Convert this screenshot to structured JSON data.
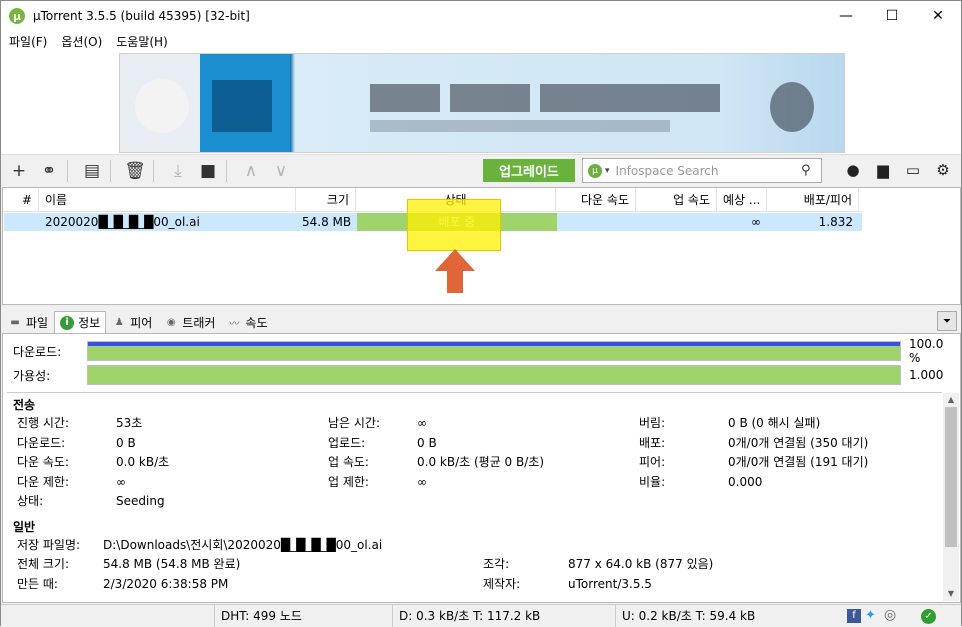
{
  "app": {
    "title": "µTorrent 3.5.5  (build 45395) [32-bit]",
    "logo": "µ"
  },
  "window_controls": {
    "minimize": "—",
    "maximize": "☐",
    "close": "✕"
  },
  "menu": [
    "파일(F)",
    "옵션(O)",
    "도움말(H)"
  ],
  "toolbar": {
    "upgrade_label": "업그레이드",
    "search_placeholder": "Infospace Search"
  },
  "columns": [
    "#",
    "이름",
    "크기",
    "상태",
    "다운 속도",
    "업 속도",
    "예상 ...",
    "배포/피어"
  ],
  "torrent": {
    "name": "2020020█_█_█_█00_ol.ai",
    "size": "54.8 MB",
    "status": "배포 중",
    "eta": "∞",
    "ratio": "1.832"
  },
  "tabs": [
    "파일",
    "정보",
    "피어",
    "트래커",
    "속도"
  ],
  "progress": {
    "download_label": "다운로드:",
    "download_value": "100.0 %",
    "availability_label": "가용성:",
    "availability_value": "1.000",
    "download_fraction": 1.0
  },
  "transfer": {
    "section": "전송",
    "elapsed_label": "진행 시간:",
    "elapsed": "53초",
    "remaining_label": "남은 시간:",
    "remaining": "∞",
    "wasted_label": "버림:",
    "wasted": "0 B (0 해시 실패)",
    "downloaded_label": "다운로드:",
    "downloaded": "0 B",
    "uploaded_label": "업로드:",
    "uploaded": "0 B",
    "seeds_label": "배포:",
    "seeds": "0개/0개 연결됨 (350 대기)",
    "dlspeed_label": "다운 속도:",
    "dlspeed": "0.0 kB/초",
    "ulspeed_label": "업 속도:",
    "ulspeed": "0.0 kB/초 (평균 0 B/초)",
    "peers_label": "피어:",
    "peers": "0개/0개 연결됨 (191 대기)",
    "dllimit_label": "다운 제한:",
    "dllimit": "∞",
    "ullimit_label": "업 제한:",
    "ullimit": "∞",
    "ratio_label": "비율:",
    "ratio": "0.000",
    "status_label": "상태:",
    "status": "Seeding"
  },
  "general": {
    "section": "일반",
    "path_label": "저장 파일명:",
    "path": "D:\\Downloads\\전시회\\2020020█_█_█_█00_ol.ai",
    "total_label": "전체 크기:",
    "total": "54.8 MB (54.8 MB 완료)",
    "pieces_label": "조각:",
    "pieces": "877 x 64.0 kB (877 있음)",
    "created_label": "만든 때:",
    "created": "2/3/2020 6:38:58 PM",
    "creator_label": "제작자:",
    "creator": "uTorrent/3.5.5"
  },
  "statusbar": {
    "dht": "DHT: 499 노드",
    "down": "D: 0.3 kB/초 T: 117.2 kB",
    "up": "U: 0.2 kB/초 T: 59.4 kB"
  },
  "colors": {
    "accent": "#68b23d",
    "progress": "#9fd46c",
    "selected_row": "#cce8ff",
    "highlight": "#fff000",
    "arrow": "#e0663a"
  }
}
